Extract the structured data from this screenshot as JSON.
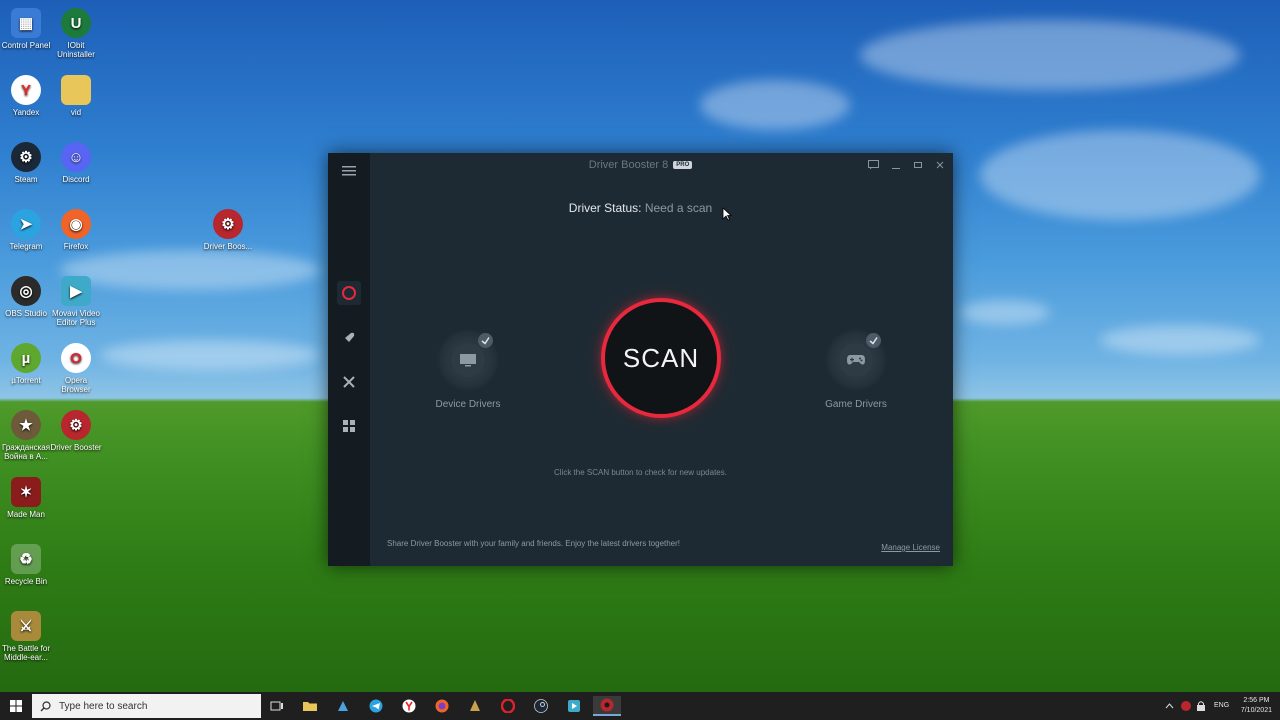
{
  "desktop": {
    "icons": [
      {
        "label": "Control Panel"
      },
      {
        "label": "IObit Uninstaller"
      },
      {
        "label": "Yandex"
      },
      {
        "label": "vid"
      },
      {
        "label": "Steam"
      },
      {
        "label": "Discord"
      },
      {
        "label": "Telegram"
      },
      {
        "label": "Firefox"
      },
      {
        "label": "Driver Boos..."
      },
      {
        "label": "OBS Studio"
      },
      {
        "label": "Movavi Video Editor Plus"
      },
      {
        "label": "µTorrent"
      },
      {
        "label": "Opera Browser"
      },
      {
        "label": "Гражданская Война в А..."
      },
      {
        "label": "Driver Booster"
      },
      {
        "label": "Made Man"
      },
      {
        "label": "Recycle Bin"
      },
      {
        "label": "The Battle for Middle-ear..."
      }
    ]
  },
  "app": {
    "title": "Driver Booster 8",
    "badge": "PRO",
    "status_label": "Driver Status:",
    "status_value": "Need a scan",
    "scan_label": "SCAN",
    "device_drivers_label": "Device Drivers",
    "game_drivers_label": "Game Drivers",
    "hint": "Click the SCAN button to check for new updates.",
    "share_text": "Share Driver Booster with your family and friends. Enjoy the latest drivers together!",
    "manage_license": "Manage License",
    "accent_color": "#e8283c"
  },
  "taskbar": {
    "search_placeholder": "Type here to search",
    "language": "ENG",
    "time": "2:56 PM",
    "date": "7/10/2021"
  }
}
